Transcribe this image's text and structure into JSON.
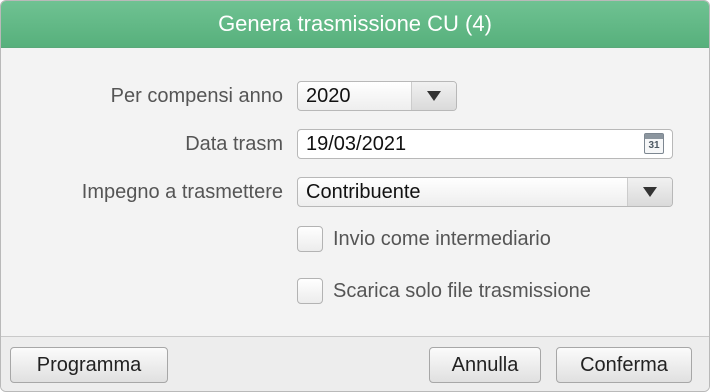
{
  "dialog": {
    "title": "Genera trasmissione CU (4)"
  },
  "form": {
    "anno_label": "Per compensi anno",
    "anno_value": "2020",
    "data_label": "Data trasm",
    "data_value": "19/03/2021",
    "calendar_day": "31",
    "impegno_label": "Impegno a trasmettere",
    "impegno_value": "Contribuente",
    "intermediario_label": "Invio come intermediario",
    "intermediario_checked": false,
    "scarica_label": "Scarica solo file trasmissione",
    "scarica_checked": false
  },
  "footer": {
    "programma_label": "Programma",
    "annulla_label": "Annulla",
    "conferma_label": "Conferma"
  },
  "colors": {
    "titlebar": "#5fb885",
    "title_text": "#ffffff"
  }
}
